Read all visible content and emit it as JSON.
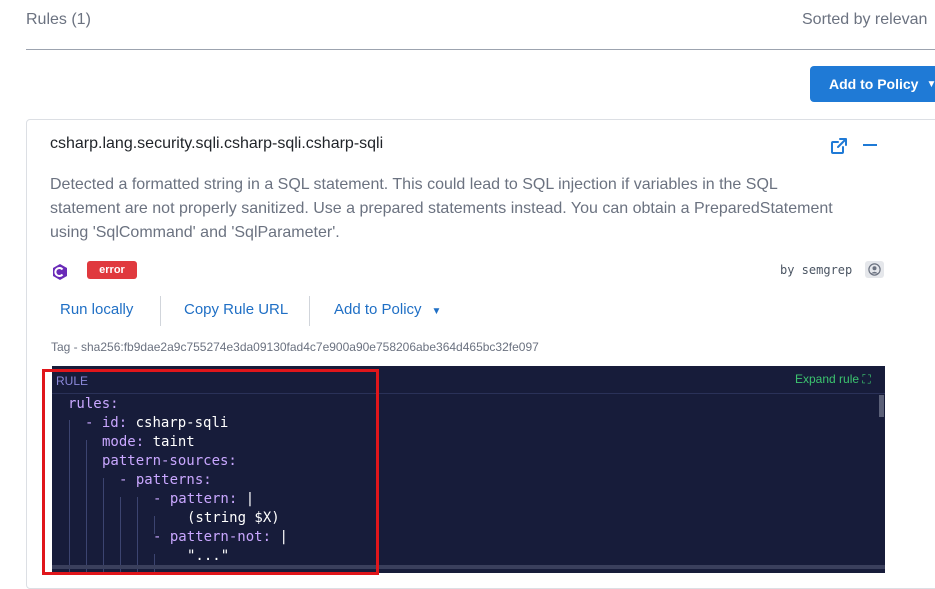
{
  "header": {
    "rules_count": "Rules (1)",
    "sort_label": "Sorted by relevan"
  },
  "primary_action": {
    "label": "Add to Policy"
  },
  "rule": {
    "id": "csharp.lang.security.sqli.csharp-sqli.csharp-sqli",
    "description": "Detected a formatted string in a SQL statement. This could lead to SQL injection if variables in the SQL statement are not properly sanitized. Use a prepared statements instead. You can obtain a PreparedStatement using 'SqlCommand' and 'SqlParameter'.",
    "language_icon": "csharp-icon",
    "severity": "error",
    "author": "by semgrep",
    "actions": {
      "run_locally": "Run locally",
      "copy_url": "Copy Rule URL",
      "add_to_policy": "Add to Policy"
    },
    "tag": "Tag - sha256:fb9dae2a9c755274e3da09130fad4c7e900a90e758206abe364d465bc32fe097"
  },
  "code": {
    "label": "RULE",
    "expand": "Expand rule",
    "lines": [
      {
        "key": "rules:",
        "value": ""
      },
      {
        "key": "- id:",
        "value": " csharp-sqli"
      },
      {
        "key": "mode:",
        "value": " taint"
      },
      {
        "key": "pattern-sources:",
        "value": ""
      },
      {
        "key": "- patterns:",
        "value": ""
      },
      {
        "key": "- pattern:",
        "value": " |"
      },
      {
        "key": "",
        "value": "(string $X)"
      },
      {
        "key": "- pattern-not:",
        "value": " |"
      },
      {
        "key": "",
        "value": "\"...\""
      }
    ]
  },
  "colors": {
    "accent": "#1f7ad6",
    "severity_error": "#e0393e",
    "code_bg": "#171c3a",
    "highlight": "#e0161b"
  }
}
